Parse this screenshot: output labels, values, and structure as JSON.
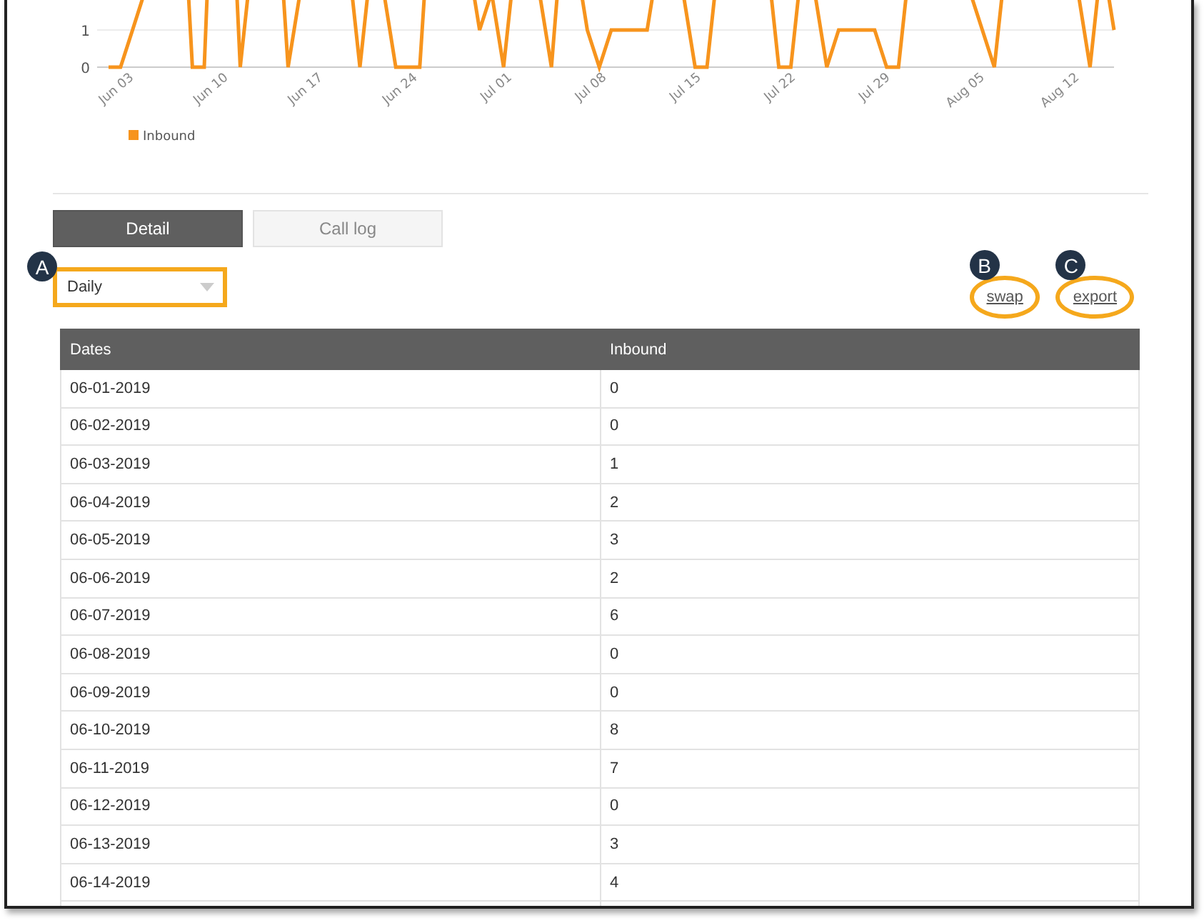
{
  "chart": {
    "y_ticks": [
      "1",
      "0"
    ],
    "x_labels": [
      "Jun 03",
      "Jun 10",
      "Jun 17",
      "Jun 24",
      "Jul 01",
      "Jul 08",
      "Jul 15",
      "Jul 22",
      "Jul 29",
      "Aug 05",
      "Aug 12"
    ],
    "legend": "Inbound"
  },
  "tabs": [
    {
      "label": "Detail",
      "selected": true
    },
    {
      "label": "Call log",
      "selected": false
    }
  ],
  "period_select": {
    "value": "Daily",
    "annotation": "A"
  },
  "links": [
    {
      "label": "swap",
      "annotation": "B"
    },
    {
      "label": "export",
      "annotation": "C"
    }
  ],
  "table": {
    "columns": [
      "Dates",
      "Inbound"
    ],
    "rows": [
      [
        "06-01-2019",
        "0"
      ],
      [
        "06-02-2019",
        "0"
      ],
      [
        "06-03-2019",
        "1"
      ],
      [
        "06-04-2019",
        "2"
      ],
      [
        "06-05-2019",
        "3"
      ],
      [
        "06-06-2019",
        "2"
      ],
      [
        "06-07-2019",
        "6"
      ],
      [
        "06-08-2019",
        "0"
      ],
      [
        "06-09-2019",
        "0"
      ],
      [
        "06-10-2019",
        "8"
      ],
      [
        "06-11-2019",
        "7"
      ],
      [
        "06-12-2019",
        "0"
      ],
      [
        "06-13-2019",
        "3"
      ],
      [
        "06-14-2019",
        "4"
      ]
    ]
  }
}
